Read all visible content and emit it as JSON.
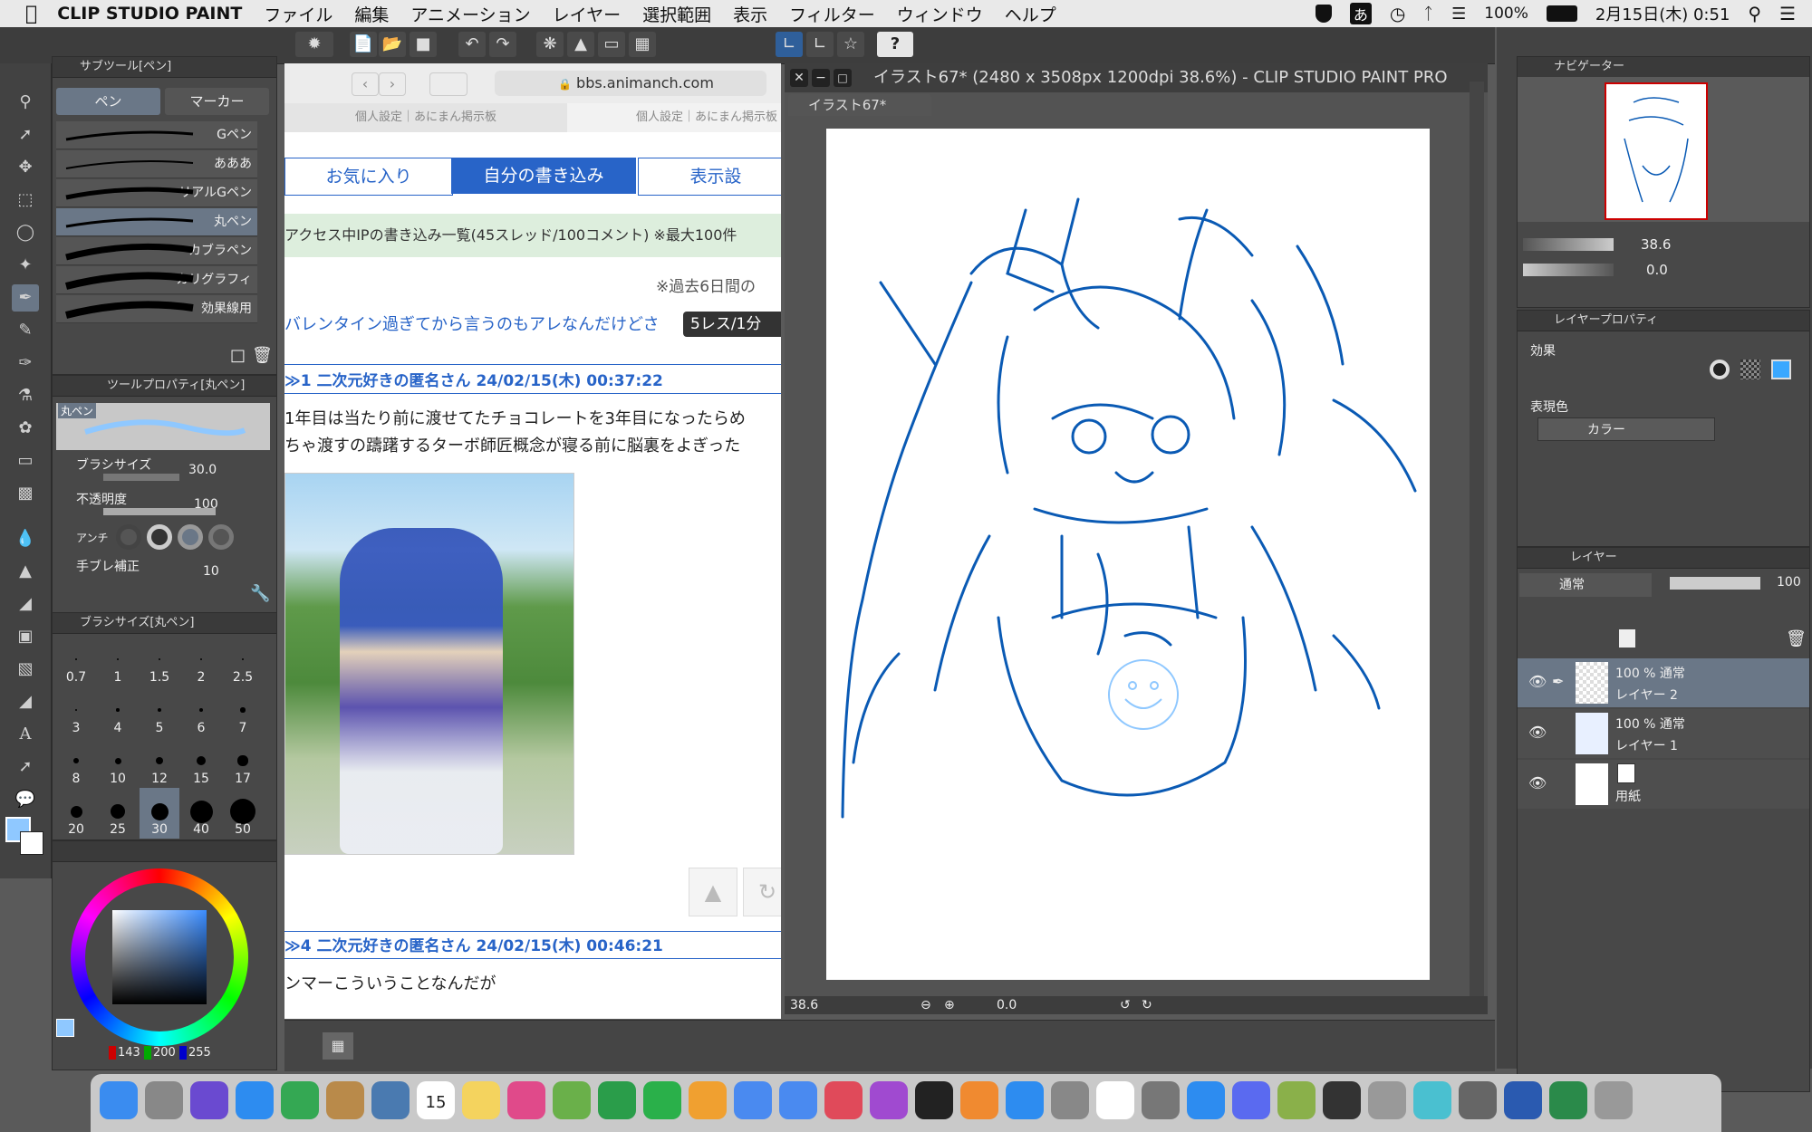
{
  "menubar": {
    "app_name": "CLIP STUDIO PAINT",
    "items": [
      "ファイル",
      "編集",
      "アニメーション",
      "レイヤー",
      "選択範囲",
      "表示",
      "フィルター",
      "ウィンドウ",
      "ヘルプ"
    ],
    "ime": "あ",
    "battery": "100%",
    "datetime": "2月15日(木)  0:51"
  },
  "subtool": {
    "title": "サブツール[ペン]",
    "tabs": [
      "ペン",
      "マーカー"
    ],
    "brushes": [
      "Gペン",
      "あああ",
      "リアルGペン",
      "丸ペン",
      "カブラペン",
      "カリグラフィ",
      "効果線用"
    ],
    "selected_index": 3
  },
  "toolprop": {
    "title": "ツールプロパティ[丸ペン]",
    "preview_name": "丸ペン",
    "brush_size_label": "ブラシサイズ",
    "brush_size_value": "30.0",
    "opacity_label": "不透明度",
    "opacity_value": "100",
    "aa_label": "アンチ",
    "stabilization_label": "手ブレ補正",
    "stabilization_value": "10"
  },
  "brushsize": {
    "title": "ブラシサイズ[丸ペン]",
    "sizes": [
      "0.7",
      "1",
      "1.5",
      "2",
      "2.5",
      "3",
      "4",
      "5",
      "6",
      "7",
      "8",
      "10",
      "12",
      "15",
      "17",
      "20",
      "25",
      "30",
      "40",
      "50"
    ],
    "selected": "30"
  },
  "color": {
    "r": "143",
    "g": "200",
    "b": "255",
    "main": "#8fc8ff"
  },
  "browser": {
    "url": "bbs.animanch.com",
    "tab1": "個人設定｜あにまん掲示板",
    "tab2": "個人設定｜あにまん掲示板",
    "nav_tabs": [
      "お気に入り",
      "自分の書き込み",
      "表示設"
    ],
    "info": "アクセス中IPの書き込み一覧(45スレッド/100コメント) ※最大100件",
    "note": "※過去6日間の",
    "thread_title": "バレンタイン過ぎてから言うのもアレなんだけどさ",
    "thread_badge": "5レス/1分",
    "post1_head": "≫1  二次元好きの匿名さん 24/02/15(木) 00:37:22",
    "post1_line1": "1年目は当たり前に渡せてたチョコレートを3年目になったらめ",
    "post1_line2": "ちゃ渡すの躊躇するターボ師匠概念が寝る前に脳裏をよぎった",
    "post4_head": "≫4  二次元好きの匿名さん 24/02/15(木) 00:46:21",
    "post4_line1": "ンマーこういうことなんだが"
  },
  "canvas": {
    "title": "イラスト67* (2480 x 3508px 1200dpi 38.6%)  - CLIP STUDIO PAINT PRO",
    "tab": "イラスト67*",
    "zoom": "38.6",
    "rotation": "0.0",
    "line_color": "#0a5ab4"
  },
  "navigator": {
    "title": "ナビゲーター",
    "zoom": "38.6",
    "rotation": "0.0"
  },
  "layerprop": {
    "title": "レイヤープロパティ",
    "effect_label": "効果",
    "expression_label": "表現色",
    "expression_value": "カラー"
  },
  "layers": {
    "title": "レイヤー",
    "blend": "通常",
    "opacity": "100",
    "items": [
      {
        "info": "100 %  通常",
        "name": "レイヤー 2"
      },
      {
        "info": "100 %  通常",
        "name": "レイヤー 1"
      },
      {
        "info": "",
        "name": "用紙"
      }
    ]
  },
  "dock": {
    "calendar_day": "15"
  }
}
